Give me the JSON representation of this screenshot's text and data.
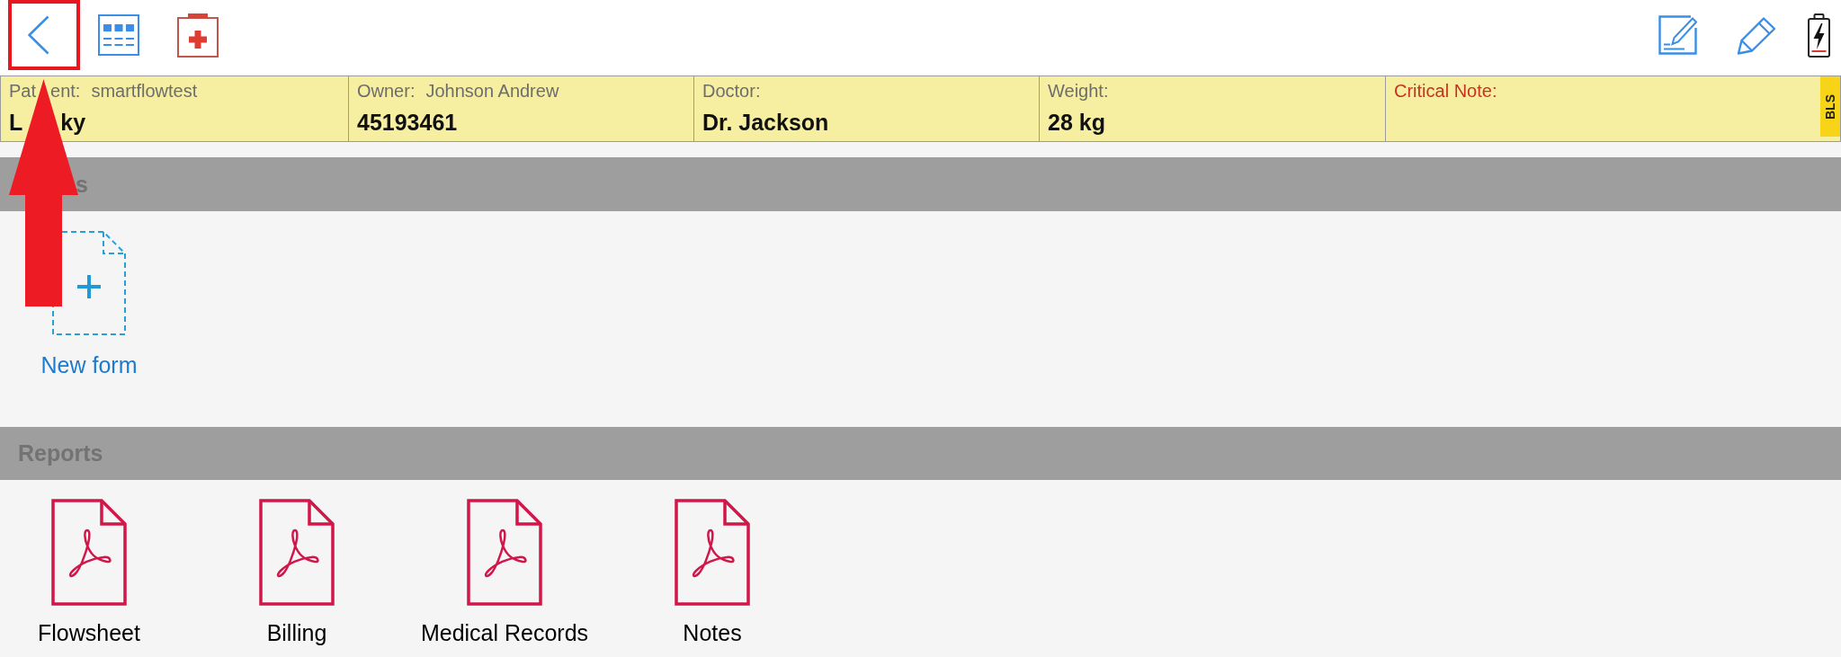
{
  "annotations": {
    "highlight_box": true,
    "arrow": true
  },
  "patient_header": {
    "fields": [
      {
        "label": [
          "Pat",
          "ent:"
        ],
        "detail": "smartflowtest",
        "value": [
          "L",
          "ky"
        ],
        "critical": false
      },
      {
        "label": [
          "Owner:"
        ],
        "detail": "Johnson Andrew",
        "value": [
          "45193461"
        ],
        "critical": false
      },
      {
        "label": [
          "Doctor:"
        ],
        "value": [
          "Dr. Jackson"
        ],
        "critical": false
      },
      {
        "label": [
          "Weight:"
        ],
        "value": [
          "28 kg"
        ],
        "critical": false
      },
      {
        "label": [
          "Critical Note:"
        ],
        "critical": true
      }
    ],
    "tag": "BLS"
  },
  "sections": [
    {
      "title": "s",
      "items": [
        {
          "kind": "new_form",
          "label": "New form"
        }
      ]
    },
    {
      "title": "Reports",
      "items": [
        {
          "kind": "pdf",
          "label": "Flowsheet"
        },
        {
          "kind": "pdf",
          "label": "Billing"
        },
        {
          "kind": "pdf",
          "label": "Medical Records"
        },
        {
          "kind": "pdf",
          "label": "Notes"
        }
      ]
    }
  ]
}
